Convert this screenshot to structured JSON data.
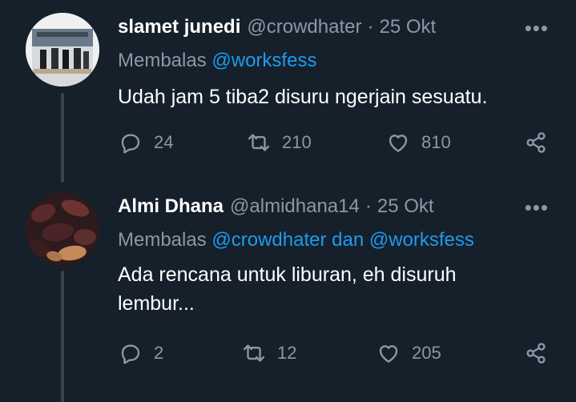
{
  "tweets": [
    {
      "name": "slamet junedi",
      "handle": "@crowdhater",
      "separator": "·",
      "date": "25 Okt",
      "replying_prefix": "Membalas",
      "replying_mentions": "@worksfess",
      "text": "Udah jam 5 tiba2 disuru ngerjain sesuatu.",
      "replies": "24",
      "retweets": "210",
      "likes": "810"
    },
    {
      "name": "Almi Dhana",
      "handle": "@almidhana14",
      "separator": "·",
      "date": "25 Okt",
      "replying_prefix": "Membalas",
      "replying_mentions": "@crowdhater dan @worksfess",
      "text": "Ada rencana untuk liburan, eh disuruh lembur...",
      "replies": "2",
      "retweets": "12",
      "likes": "205"
    }
  ],
  "colors": {
    "background": "#15202b",
    "text_primary": "#ffffff",
    "text_secondary": "#8b98a5",
    "accent": "#1d9bf0",
    "thread_line": "#38444d"
  },
  "icons": [
    "reply-icon",
    "retweet-icon",
    "like-icon",
    "share-icon",
    "more-icon"
  ]
}
